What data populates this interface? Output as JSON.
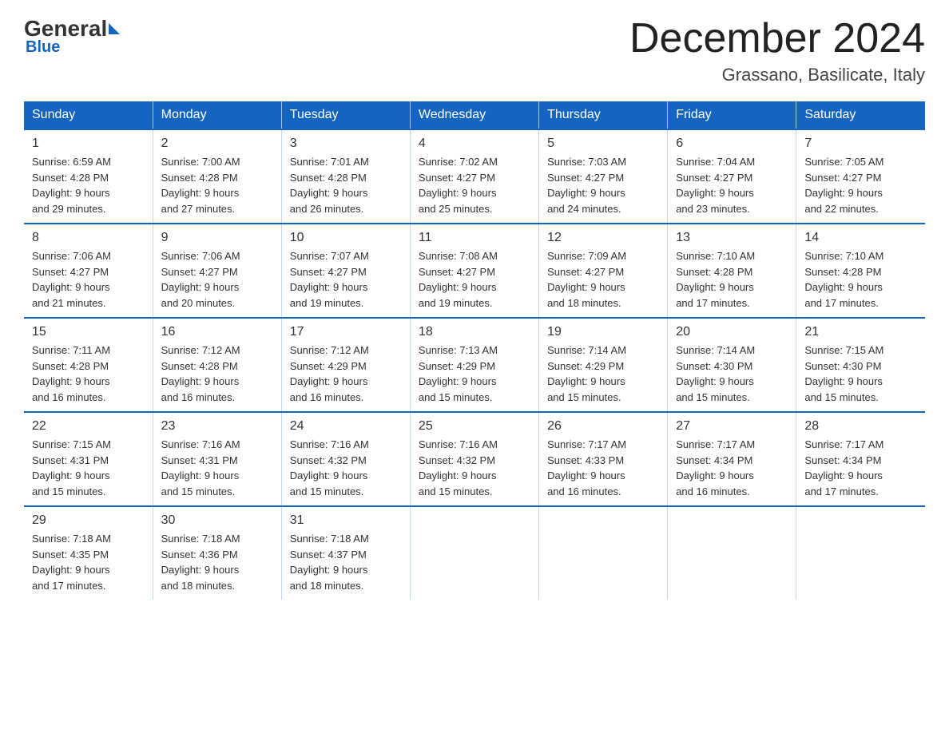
{
  "header": {
    "logo_general": "General",
    "logo_blue": "Blue",
    "month_title": "December 2024",
    "location": "Grassano, Basilicate, Italy"
  },
  "days_of_week": [
    "Sunday",
    "Monday",
    "Tuesday",
    "Wednesday",
    "Thursday",
    "Friday",
    "Saturday"
  ],
  "weeks": [
    [
      {
        "day": "1",
        "info": "Sunrise: 6:59 AM\nSunset: 4:28 PM\nDaylight: 9 hours\nand 29 minutes."
      },
      {
        "day": "2",
        "info": "Sunrise: 7:00 AM\nSunset: 4:28 PM\nDaylight: 9 hours\nand 27 minutes."
      },
      {
        "day": "3",
        "info": "Sunrise: 7:01 AM\nSunset: 4:28 PM\nDaylight: 9 hours\nand 26 minutes."
      },
      {
        "day": "4",
        "info": "Sunrise: 7:02 AM\nSunset: 4:27 PM\nDaylight: 9 hours\nand 25 minutes."
      },
      {
        "day": "5",
        "info": "Sunrise: 7:03 AM\nSunset: 4:27 PM\nDaylight: 9 hours\nand 24 minutes."
      },
      {
        "day": "6",
        "info": "Sunrise: 7:04 AM\nSunset: 4:27 PM\nDaylight: 9 hours\nand 23 minutes."
      },
      {
        "day": "7",
        "info": "Sunrise: 7:05 AM\nSunset: 4:27 PM\nDaylight: 9 hours\nand 22 minutes."
      }
    ],
    [
      {
        "day": "8",
        "info": "Sunrise: 7:06 AM\nSunset: 4:27 PM\nDaylight: 9 hours\nand 21 minutes."
      },
      {
        "day": "9",
        "info": "Sunrise: 7:06 AM\nSunset: 4:27 PM\nDaylight: 9 hours\nand 20 minutes."
      },
      {
        "day": "10",
        "info": "Sunrise: 7:07 AM\nSunset: 4:27 PM\nDaylight: 9 hours\nand 19 minutes."
      },
      {
        "day": "11",
        "info": "Sunrise: 7:08 AM\nSunset: 4:27 PM\nDaylight: 9 hours\nand 19 minutes."
      },
      {
        "day": "12",
        "info": "Sunrise: 7:09 AM\nSunset: 4:27 PM\nDaylight: 9 hours\nand 18 minutes."
      },
      {
        "day": "13",
        "info": "Sunrise: 7:10 AM\nSunset: 4:28 PM\nDaylight: 9 hours\nand 17 minutes."
      },
      {
        "day": "14",
        "info": "Sunrise: 7:10 AM\nSunset: 4:28 PM\nDaylight: 9 hours\nand 17 minutes."
      }
    ],
    [
      {
        "day": "15",
        "info": "Sunrise: 7:11 AM\nSunset: 4:28 PM\nDaylight: 9 hours\nand 16 minutes."
      },
      {
        "day": "16",
        "info": "Sunrise: 7:12 AM\nSunset: 4:28 PM\nDaylight: 9 hours\nand 16 minutes."
      },
      {
        "day": "17",
        "info": "Sunrise: 7:12 AM\nSunset: 4:29 PM\nDaylight: 9 hours\nand 16 minutes."
      },
      {
        "day": "18",
        "info": "Sunrise: 7:13 AM\nSunset: 4:29 PM\nDaylight: 9 hours\nand 15 minutes."
      },
      {
        "day": "19",
        "info": "Sunrise: 7:14 AM\nSunset: 4:29 PM\nDaylight: 9 hours\nand 15 minutes."
      },
      {
        "day": "20",
        "info": "Sunrise: 7:14 AM\nSunset: 4:30 PM\nDaylight: 9 hours\nand 15 minutes."
      },
      {
        "day": "21",
        "info": "Sunrise: 7:15 AM\nSunset: 4:30 PM\nDaylight: 9 hours\nand 15 minutes."
      }
    ],
    [
      {
        "day": "22",
        "info": "Sunrise: 7:15 AM\nSunset: 4:31 PM\nDaylight: 9 hours\nand 15 minutes."
      },
      {
        "day": "23",
        "info": "Sunrise: 7:16 AM\nSunset: 4:31 PM\nDaylight: 9 hours\nand 15 minutes."
      },
      {
        "day": "24",
        "info": "Sunrise: 7:16 AM\nSunset: 4:32 PM\nDaylight: 9 hours\nand 15 minutes."
      },
      {
        "day": "25",
        "info": "Sunrise: 7:16 AM\nSunset: 4:32 PM\nDaylight: 9 hours\nand 15 minutes."
      },
      {
        "day": "26",
        "info": "Sunrise: 7:17 AM\nSunset: 4:33 PM\nDaylight: 9 hours\nand 16 minutes."
      },
      {
        "day": "27",
        "info": "Sunrise: 7:17 AM\nSunset: 4:34 PM\nDaylight: 9 hours\nand 16 minutes."
      },
      {
        "day": "28",
        "info": "Sunrise: 7:17 AM\nSunset: 4:34 PM\nDaylight: 9 hours\nand 17 minutes."
      }
    ],
    [
      {
        "day": "29",
        "info": "Sunrise: 7:18 AM\nSunset: 4:35 PM\nDaylight: 9 hours\nand 17 minutes."
      },
      {
        "day": "30",
        "info": "Sunrise: 7:18 AM\nSunset: 4:36 PM\nDaylight: 9 hours\nand 18 minutes."
      },
      {
        "day": "31",
        "info": "Sunrise: 7:18 AM\nSunset: 4:37 PM\nDaylight: 9 hours\nand 18 minutes."
      },
      {
        "day": "",
        "info": ""
      },
      {
        "day": "",
        "info": ""
      },
      {
        "day": "",
        "info": ""
      },
      {
        "day": "",
        "info": ""
      }
    ]
  ]
}
